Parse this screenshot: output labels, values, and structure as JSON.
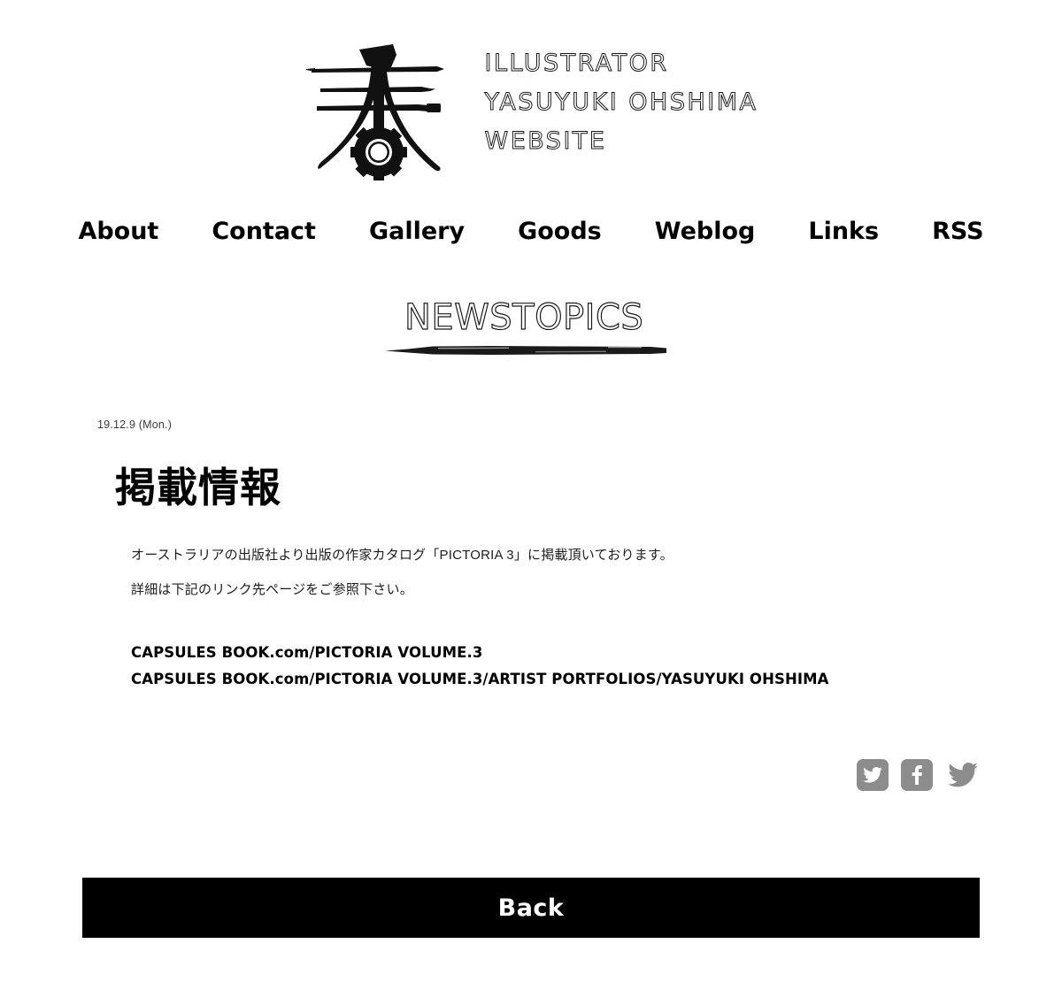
{
  "site": {
    "logo": {
      "mark_name": "kanji-brush-gear-logo",
      "wordmark_lines": [
        "ILLUSTRATOR",
        "YASUYUKI OHSHIMA",
        "WEBSITE"
      ]
    },
    "nav": [
      {
        "label": "About",
        "name": "about"
      },
      {
        "label": "Contact",
        "name": "contact"
      },
      {
        "label": "Gallery",
        "name": "gallery"
      },
      {
        "label": "Goods",
        "name": "goods"
      },
      {
        "label": "Weblog",
        "name": "weblog"
      },
      {
        "label": "Links",
        "name": "links"
      },
      {
        "label": "RSS",
        "name": "rss"
      }
    ]
  },
  "section": {
    "title": "NEWSTOPICS"
  },
  "article": {
    "date": "19.12.9 (Mon.)",
    "title": "掲載情報",
    "paragraphs": [
      "オーストラリアの出版社より出版の作家カタログ「PICTORIA 3」に掲載頂いております。",
      "詳細は下記のリンク先ページをご参照下さい。"
    ],
    "links": [
      "CAPSULES BOOK.com/PICTORIA VOLUME.3",
      "CAPSULES BOOK.com/PICTORIA VOLUME.3/ARTIST PORTFOLIOS/YASUYUKI OHSHIMA"
    ]
  },
  "social": [
    {
      "name": "twitter-share-button",
      "icon": "twitter-icon",
      "style": "boxed"
    },
    {
      "name": "facebook-share-button",
      "icon": "facebook-icon",
      "style": "boxed"
    },
    {
      "name": "twitter-follow-button",
      "icon": "twitter-icon",
      "style": "plain"
    }
  ],
  "footer": {
    "back_label": "Back"
  },
  "colors": {
    "background": "#ffffff",
    "text": "#111111",
    "social_gray": "#8c8c8c",
    "bar_black": "#000000"
  }
}
